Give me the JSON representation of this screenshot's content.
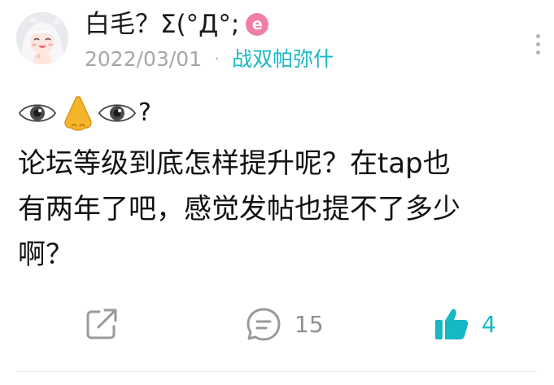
{
  "post": {
    "author": {
      "name": "白毛？Σ(°Д°;",
      "badge": "e",
      "avatar_icon": "white-haired-girl-avatar"
    },
    "date": "2022/03/01",
    "separator": "·",
    "forum": "战双帕弥什",
    "emoji_sequence": [
      "eye-emoji",
      "nose-emoji",
      "eye-emoji"
    ],
    "emoji_suffix": "?",
    "body_lines": [
      "论坛等级到底怎样提升呢？在tap也",
      "有两年了吧，感觉发帖也提不了多少",
      "啊？"
    ],
    "actions": {
      "share_icon": "share-icon",
      "comment_icon": "comment-icon",
      "comment_count": "15",
      "like_icon": "thumbs-up-icon",
      "like_count": "4"
    }
  },
  "colors": {
    "accent": "#16b8c4",
    "badge": "#f07fa6",
    "meta": "#a7a7a7",
    "icon": "#9a9a9a"
  }
}
